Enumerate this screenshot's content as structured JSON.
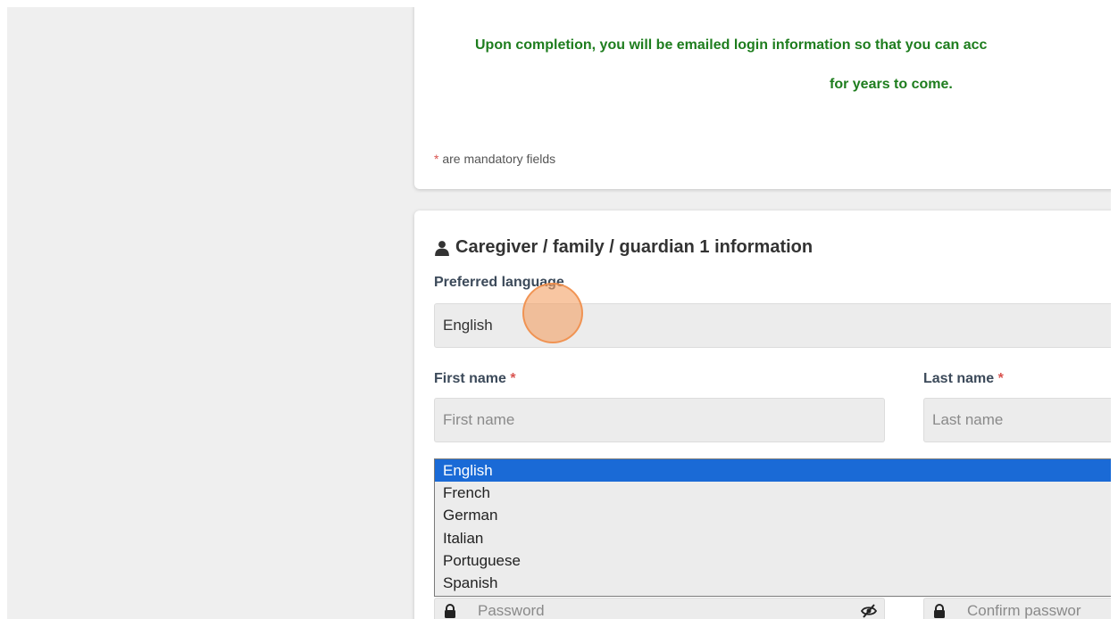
{
  "intro": {
    "line1": "Upon completion, you will be emailed login information so that you can acc",
    "line2": "for years to come.",
    "mandatory_star": "*",
    "mandatory_text": " are mandatory fields"
  },
  "section": {
    "title": "Caregiver / family / guardian 1 information",
    "icon": "user-icon"
  },
  "form": {
    "preferred_language_label": "Preferred language",
    "preferred_language_value": "English",
    "first_name_label": "First name",
    "first_name_placeholder": "First name",
    "last_name_label": "Last name",
    "last_name_placeholder": "Last name",
    "required_marker": "*",
    "password_placeholder": "Password",
    "confirm_password_placeholder": "Confirm passwor"
  },
  "language_options": [
    "English",
    "French",
    "German",
    "Italian",
    "Portuguese",
    "Spanish"
  ],
  "selected_option": "English",
  "colors": {
    "accent_green": "#1e7d1e",
    "selection_blue": "#1a6ad6",
    "required_red": "#d9534f",
    "click_indicator": "#f4a064"
  }
}
